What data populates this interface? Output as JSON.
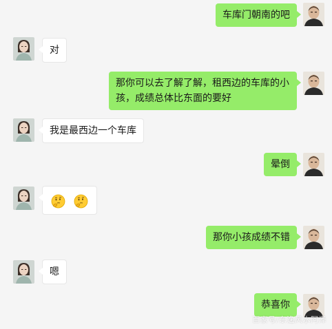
{
  "colors": {
    "background": "#f5f5f5",
    "bubble_out": "#95ec69",
    "bubble_in": "#ffffff"
  },
  "messages": [
    {
      "side": "out",
      "text": "车库门朝南的吧"
    },
    {
      "side": "in",
      "text": "对"
    },
    {
      "side": "out",
      "text": "那你可以去了解了解，租西边的车库的小孩，成绩总体比东面的要好"
    },
    {
      "side": "in",
      "text": "我是最西边一个车库"
    },
    {
      "side": "out",
      "text": "晕倒"
    },
    {
      "side": "in",
      "emoji": [
        "thinking-face-emoji",
        "thinking-face-emoji"
      ]
    },
    {
      "side": "out",
      "text": "那你小孩成绩不错"
    },
    {
      "side": "in",
      "text": "嗯"
    },
    {
      "side": "out",
      "text": "恭喜你"
    }
  ],
  "watermark": "百家号/东逸风水阿泽"
}
